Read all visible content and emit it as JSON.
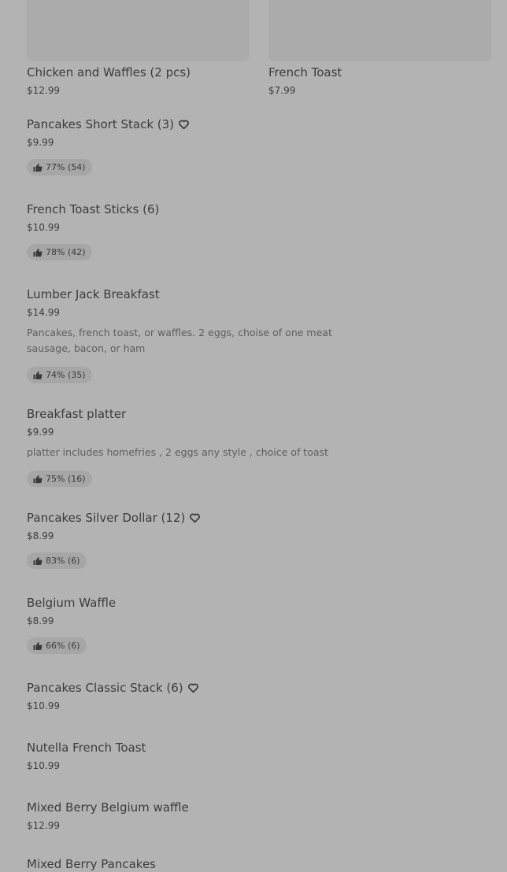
{
  "featured": [
    {
      "name": "Chicken and Waffles (2 pcs)",
      "price": "$12.99"
    },
    {
      "name": "French Toast",
      "price": "$7.99"
    }
  ],
  "items": [
    {
      "name": "Pancakes Short Stack (3)",
      "price": "$9.99",
      "rating": "77% (54)",
      "icon": "heart-icon"
    },
    {
      "name": "French Toast Sticks (6)",
      "price": "$10.99",
      "rating": "78% (42)"
    },
    {
      "name": "Lumber Jack Breakfast",
      "price": "$14.99",
      "description": "Pancakes, french toast, or waffles. 2 eggs, choise of one meat sausage, bacon, or ham",
      "rating": "74% (35)"
    },
    {
      "name": "Breakfast platter",
      "price": "$9.99",
      "description": "platter includes homefries , 2 eggs any style , choice of toast",
      "rating": "75% (16)"
    },
    {
      "name": "Pancakes Silver Dollar (12)",
      "price": "$8.99",
      "rating": "83% (6)",
      "icon": "heart-icon"
    },
    {
      "name": "Belgium Waffle",
      "price": "$8.99",
      "rating": "66% (6)"
    },
    {
      "name": "Pancakes Classic Stack (6)",
      "price": "$10.99",
      "icon": "heart-icon"
    },
    {
      "name": "Nutella French Toast",
      "price": "$10.99"
    },
    {
      "name": "Mixed Berry Belgium waffle",
      "price": "$12.99"
    },
    {
      "name": "Mixed Berry Pancakes",
      "price": ""
    }
  ],
  "colors": {
    "background": "#b3b3b3",
    "image_placeholder": "#ababab",
    "badge": "#a6a6a6",
    "text": "#3c3c3c",
    "description": "#5e5e5e"
  }
}
